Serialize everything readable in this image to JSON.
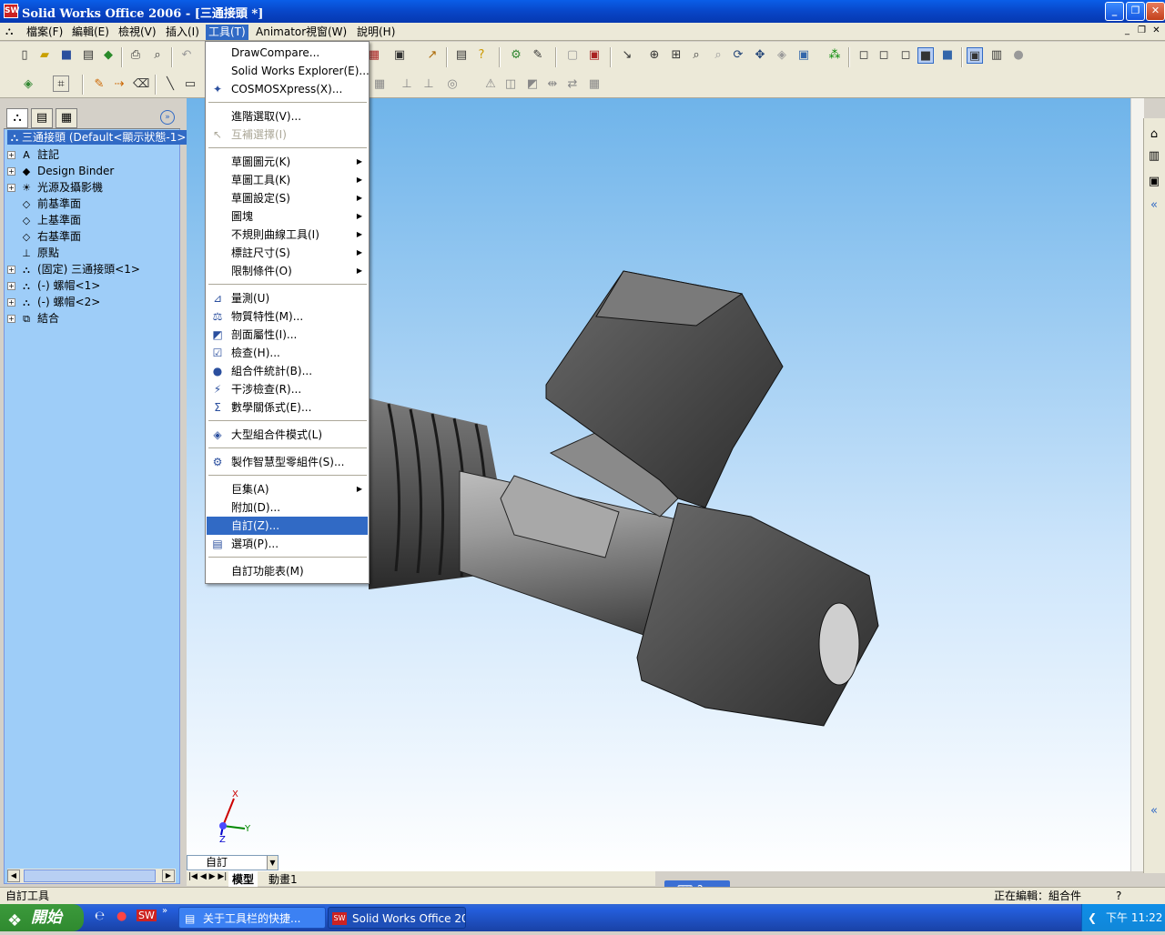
{
  "window": {
    "title": "Solid Works Office 2006 - [三通接頭 *]"
  },
  "menu": {
    "items": [
      "檔案(F)",
      "編輯(E)",
      "檢視(V)",
      "插入(I)",
      "工具(T)",
      "Animator",
      "視窗(W)",
      "說明(H)"
    ],
    "active": "工具(T)"
  },
  "tools_menu": {
    "items": [
      {
        "label": "DrawCompare...",
        "icon": ""
      },
      {
        "label": "Solid Works Explorer(E)...",
        "icon": ""
      },
      {
        "label": "COSMOSXpress(X)...",
        "icon": "cosmos-icon"
      },
      {
        "label": "進階選取(V)...",
        "icon": ""
      },
      {
        "label": "互補選擇(I)",
        "icon": "select-icon",
        "disabled": true
      },
      {
        "label": "草圖圖元(K)",
        "submenu": true
      },
      {
        "label": "草圖工具(K)",
        "submenu": true
      },
      {
        "label": "草圖設定(S)",
        "submenu": true
      },
      {
        "label": "圖塊",
        "submenu": true
      },
      {
        "label": "不規則曲線工具(I)",
        "submenu": true
      },
      {
        "label": "標註尺寸(S)",
        "submenu": true
      },
      {
        "label": "限制條件(O)",
        "submenu": true
      },
      {
        "label": "量測(U)",
        "icon": "measure-icon"
      },
      {
        "label": "物質特性(M)...",
        "icon": "mass-icon"
      },
      {
        "label": "剖面屬性(I)...",
        "icon": "section-icon"
      },
      {
        "label": "檢查(H)...",
        "icon": "check-icon"
      },
      {
        "label": "組合件統計(B)...",
        "icon": "stats-icon"
      },
      {
        "label": "干涉檢查(R)...",
        "icon": "interference-icon"
      },
      {
        "label": "數學關係式(E)...",
        "icon": "sigma-icon"
      },
      {
        "label": "大型組合件模式(L)",
        "icon": "large-asm-icon"
      },
      {
        "label": "製作智慧型零組件(S)...",
        "icon": "smart-icon"
      },
      {
        "label": "巨集(A)",
        "submenu": true
      },
      {
        "label": "附加(D)..."
      },
      {
        "label": "自訂(Z)...",
        "selected": true
      },
      {
        "label": "選項(P)...",
        "icon": "options-icon"
      },
      {
        "label": "自訂功能表(M)"
      }
    ]
  },
  "tree": {
    "root": "三通接頭 (Default<顯示狀態-1>",
    "items": [
      {
        "label": "註記",
        "icon": "annotation-icon",
        "exp": true
      },
      {
        "label": "Design Binder",
        "icon": "binder-icon",
        "exp": true
      },
      {
        "label": "光源及攝影機",
        "icon": "lights-icon",
        "exp": true
      },
      {
        "label": "前基準面",
        "icon": "plane-icon",
        "exp": false
      },
      {
        "label": "上基準面",
        "icon": "plane-icon",
        "exp": false
      },
      {
        "label": "右基準面",
        "icon": "plane-icon",
        "exp": false
      },
      {
        "label": "原點",
        "icon": "origin-icon",
        "exp": false
      },
      {
        "label": "(固定) 三通接頭<1>",
        "icon": "part-icon",
        "exp": true
      },
      {
        "label": "(-) 螺帽<1>",
        "icon": "part-icon",
        "exp": true
      },
      {
        "label": "(-) 螺帽<2>",
        "icon": "part-icon",
        "exp": true
      },
      {
        "label": "結合",
        "icon": "mates-icon",
        "exp": true
      }
    ]
  },
  "bottom": {
    "config_combo": "自訂",
    "tabs": [
      "模型",
      "動畫1"
    ]
  },
  "status": {
    "left": "自訂工具",
    "right": "正在編輯：組合件",
    "help": "?"
  },
  "taskbar": {
    "start": "開始",
    "tasks": [
      "关于工具栏的快捷...",
      "Solid Works Office 20..."
    ],
    "clock": "下午 11:22"
  },
  "triad": {
    "x": "X",
    "y": "Y",
    "z": "Z"
  }
}
